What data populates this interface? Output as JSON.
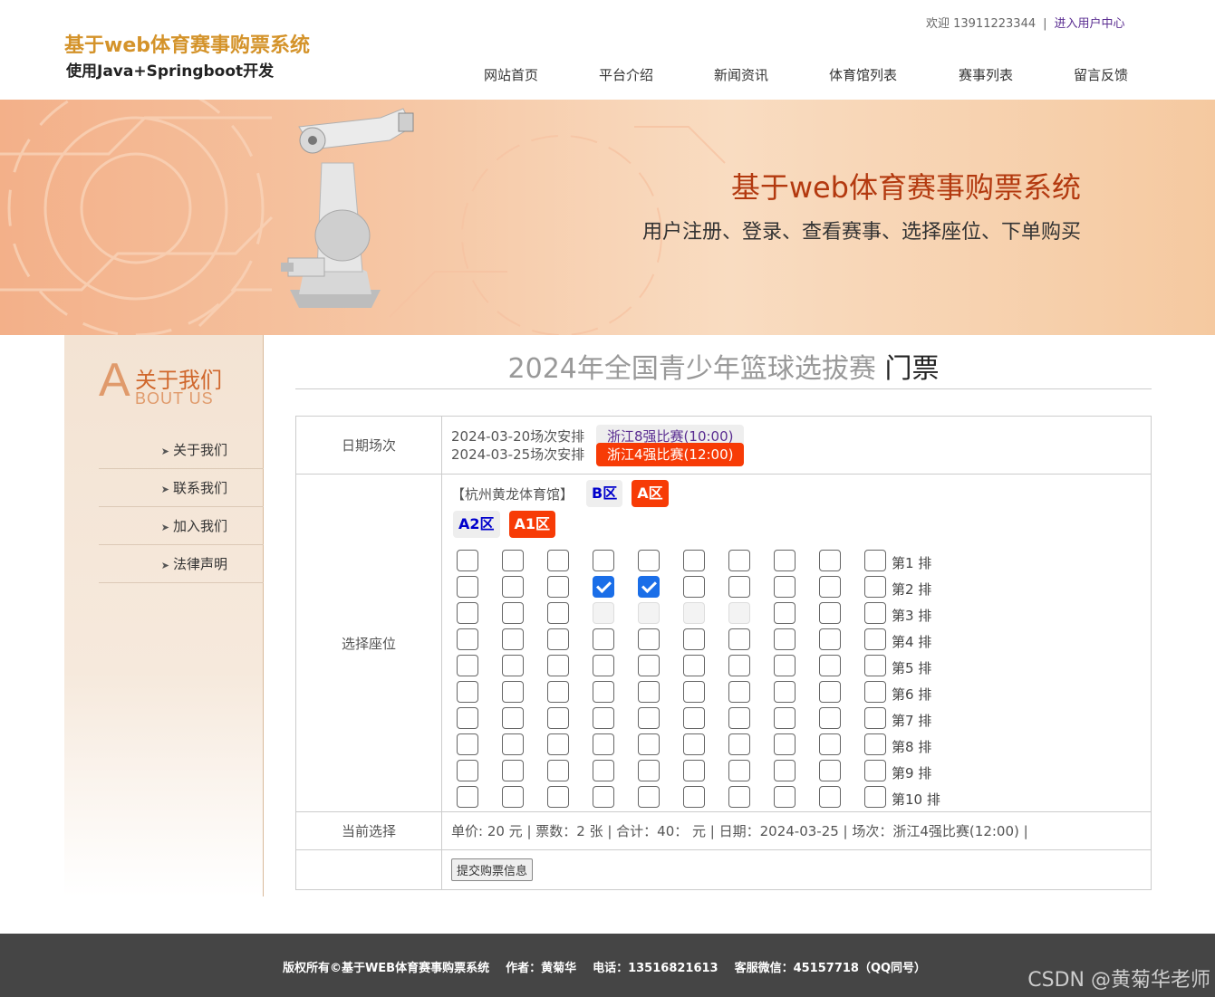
{
  "header": {
    "logo_title": "基于web体育赛事购票系统",
    "logo_sub": "使用Java+Springboot开发",
    "welcome": "欢迎 13911223344",
    "separator": "|",
    "user_center": "进入用户中心",
    "nav": [
      "网站首页",
      "平台介绍",
      "新闻资讯",
      "体育馆列表",
      "赛事列表",
      "留言反馈"
    ]
  },
  "banner": {
    "title": "基于web体育赛事购票系统",
    "subtitle": "用户注册、登录、查看赛事、选择座位、下单购买"
  },
  "sidebar": {
    "logo_letter": "A",
    "logo_cn": "关于我们",
    "logo_en": "BOUT US",
    "arrow": "➤",
    "items": [
      "关于我们",
      "联系我们",
      "加入我们",
      "法律声明"
    ]
  },
  "main": {
    "title": "2024年全国青少年篮球选拔赛",
    "title_suffix": " 门票",
    "labels": {
      "date": "日期场次",
      "seat": "选择座位",
      "current": "当前选择"
    },
    "schedule": [
      {
        "date": "2024-03-20场次安排",
        "session": "浙江8强比赛(10:00)",
        "selected": false
      },
      {
        "date": "2024-03-25场次安排",
        "session": "浙江4强比赛(12:00)",
        "selected": true
      }
    ],
    "venue": "【杭州黄龙体育馆】",
    "zones_row1": [
      {
        "label": "B区",
        "selected": false
      },
      {
        "label": "A区",
        "selected": true
      }
    ],
    "zones_row2": [
      {
        "label": "A2区",
        "selected": false
      },
      {
        "label": "A1区",
        "selected": true
      }
    ],
    "seat_rows": [
      {
        "label": "第1 排",
        "checked": [],
        "disabled": []
      },
      {
        "label": "第2 排",
        "checked": [
          4,
          5
        ],
        "disabled": []
      },
      {
        "label": "第3 排",
        "checked": [],
        "disabled": [
          4,
          5,
          6,
          7
        ]
      },
      {
        "label": "第4 排",
        "checked": [],
        "disabled": []
      },
      {
        "label": "第5 排",
        "checked": [],
        "disabled": []
      },
      {
        "label": "第6 排",
        "checked": [],
        "disabled": []
      },
      {
        "label": "第7 排",
        "checked": [],
        "disabled": []
      },
      {
        "label": "第8 排",
        "checked": [],
        "disabled": []
      },
      {
        "label": "第9 排",
        "checked": [],
        "disabled": []
      },
      {
        "label": "第10 排",
        "checked": [],
        "disabled": []
      }
    ],
    "seats_per_row": 10,
    "summary": "单价: 20 元 | 票数：2 张 | 合计：40：  元 | 日期：2024-03-25 | 场次：浙江4强比赛(12:00) |",
    "submit_label": "提交购票信息"
  },
  "footer": {
    "copyright": "版权所有©基于WEB体育赛事购票系统",
    "author": "作者：黄菊华",
    "phone": "电话：13516821613",
    "wechat": "客服微信：45157718（QQ同号）"
  },
  "watermark": "CSDN @黄菊华老师",
  "colors": {
    "accent": "#f73b06",
    "logo": "#d4932a",
    "banner_title": "#b3390f",
    "footer_bg": "#454545"
  }
}
